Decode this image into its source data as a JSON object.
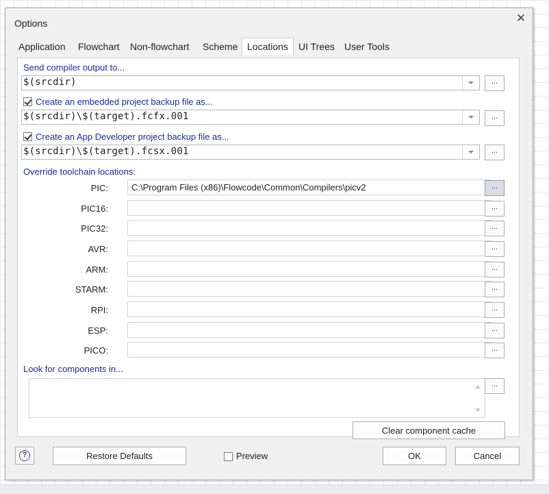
{
  "dialog": {
    "title": "Options",
    "close_glyph": "✕"
  },
  "tabs": [
    {
      "label": "Application",
      "active": false
    },
    {
      "label": "Flowchart",
      "active": false
    },
    {
      "label": "Non-flowchart",
      "active": false
    },
    {
      "label": "Scheme",
      "active": false
    },
    {
      "label": "Locations",
      "active": true
    },
    {
      "label": "UI Trees",
      "active": false
    },
    {
      "label": "User Tools",
      "active": false
    }
  ],
  "compiler_output": {
    "label": "Send compiler output to...",
    "value": "$(srcdir)"
  },
  "embedded_backup": {
    "label": "Create an embedded project backup file as...",
    "checked": true,
    "value": "$(srcdir)\\$(target).fcfx.001"
  },
  "appdev_backup": {
    "label": "Create an App Developer project backup file as...",
    "checked": true,
    "value": "$(srcdir)\\$(target).fcsx.001"
  },
  "browse_label": "...",
  "toolchain": {
    "label": "Override toolchain locations:",
    "items": [
      {
        "name": "PIC:",
        "value": "C:\\Program Files (x86)\\Flowcode\\Common\\Compilers\\picv2"
      },
      {
        "name": "PIC16:",
        "value": ""
      },
      {
        "name": "PIC32:",
        "value": ""
      },
      {
        "name": "AVR:",
        "value": ""
      },
      {
        "name": "ARM:",
        "value": ""
      },
      {
        "name": "STARM:",
        "value": ""
      },
      {
        "name": "RPI:",
        "value": ""
      },
      {
        "name": "ESP:",
        "value": ""
      },
      {
        "name": "PICO:",
        "value": ""
      }
    ]
  },
  "components": {
    "label": "Look for components in...",
    "value": ""
  },
  "clear_cache_label": "Clear component cache",
  "footer": {
    "help_glyph": "?",
    "restore_label": "Restore Defaults",
    "preview_label": "Preview",
    "preview_checked": false,
    "ok_label": "OK",
    "cancel_label": "Cancel"
  },
  "colors": {
    "label_blue": "#1a2a9a",
    "dialog_bg": "#f0f0f0",
    "panel_bg": "#ffffff"
  }
}
